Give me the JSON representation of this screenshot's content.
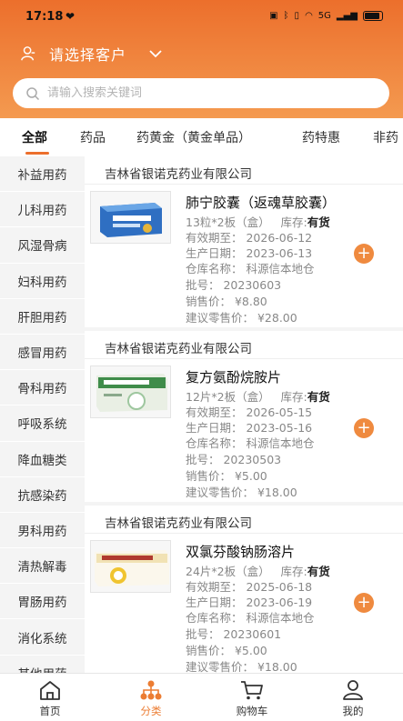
{
  "status_bar": {
    "time": "17:18",
    "network": "5G"
  },
  "header": {
    "customer_label": "请选择客户",
    "search_placeholder": "请输入搜索关键词"
  },
  "tabs": [
    {
      "label": "全部",
      "active": true
    },
    {
      "label": "药品"
    },
    {
      "label": "药黄金（黄金单品）"
    },
    {
      "label": "药特惠"
    },
    {
      "label": "非药"
    }
  ],
  "sidebar": {
    "items": [
      "补益用药",
      "儿科用药",
      "风湿骨病",
      "妇科用药",
      "肝胆用药",
      "感冒用药",
      "骨科用药",
      "呼吸系统",
      "降血糖类",
      "抗感染药",
      "男科用药",
      "清热解毒",
      "胃肠用药",
      "消化系统",
      "其他用药"
    ]
  },
  "products": [
    {
      "company": "吉林省银诺克药业有限公司",
      "name": "肺宁胶囊（返魂草胶囊）",
      "spec": "13粒*2板（盒）",
      "stock_label": "库存:",
      "stock_value": "有货",
      "expiry": "有效期至：  2026-06-12",
      "production": "生产日期：  2023-06-13",
      "warehouse": "仓库名称：  科源信本地仓",
      "batch": "批号：  20230603",
      "price": "销售价：  ¥8.80",
      "retail": "建议零售价：  ¥28.00"
    },
    {
      "company": "吉林省银诺克药业有限公司",
      "name": "复方氨酚烷胺片",
      "spec": "12片*2板（盒）",
      "stock_label": "库存:",
      "stock_value": "有货",
      "expiry": "有效期至：  2026-05-15",
      "production": "生产日期：  2023-05-16",
      "warehouse": "仓库名称：  科源信本地仓",
      "batch": "批号：  20230503",
      "price": "销售价：  ¥5.00",
      "retail": "建议零售价：  ¥18.00"
    },
    {
      "company": "吉林省银诺克药业有限公司",
      "name": "双氯芬酸钠肠溶片",
      "spec": "24片*2板（盒）",
      "stock_label": "库存:",
      "stock_value": "有货",
      "expiry": "有效期至：  2025-06-18",
      "production": "生产日期：  2023-06-19",
      "warehouse": "仓库名称：  科源信本地仓",
      "batch": "批号：  20230601",
      "price": "销售价：  ¥5.00",
      "retail": "建议零售价：  ¥18.00"
    }
  ],
  "bottom_nav": [
    {
      "label": "首页",
      "icon": "home-icon"
    },
    {
      "label": "分类",
      "icon": "category-icon",
      "active": true
    },
    {
      "label": "购物车",
      "icon": "cart-icon"
    },
    {
      "label": "我的",
      "icon": "profile-icon"
    }
  ],
  "colors": {
    "accent": "#ec6f2c",
    "accent_light": "#f49a50",
    "plus": "#ef8a3f"
  }
}
